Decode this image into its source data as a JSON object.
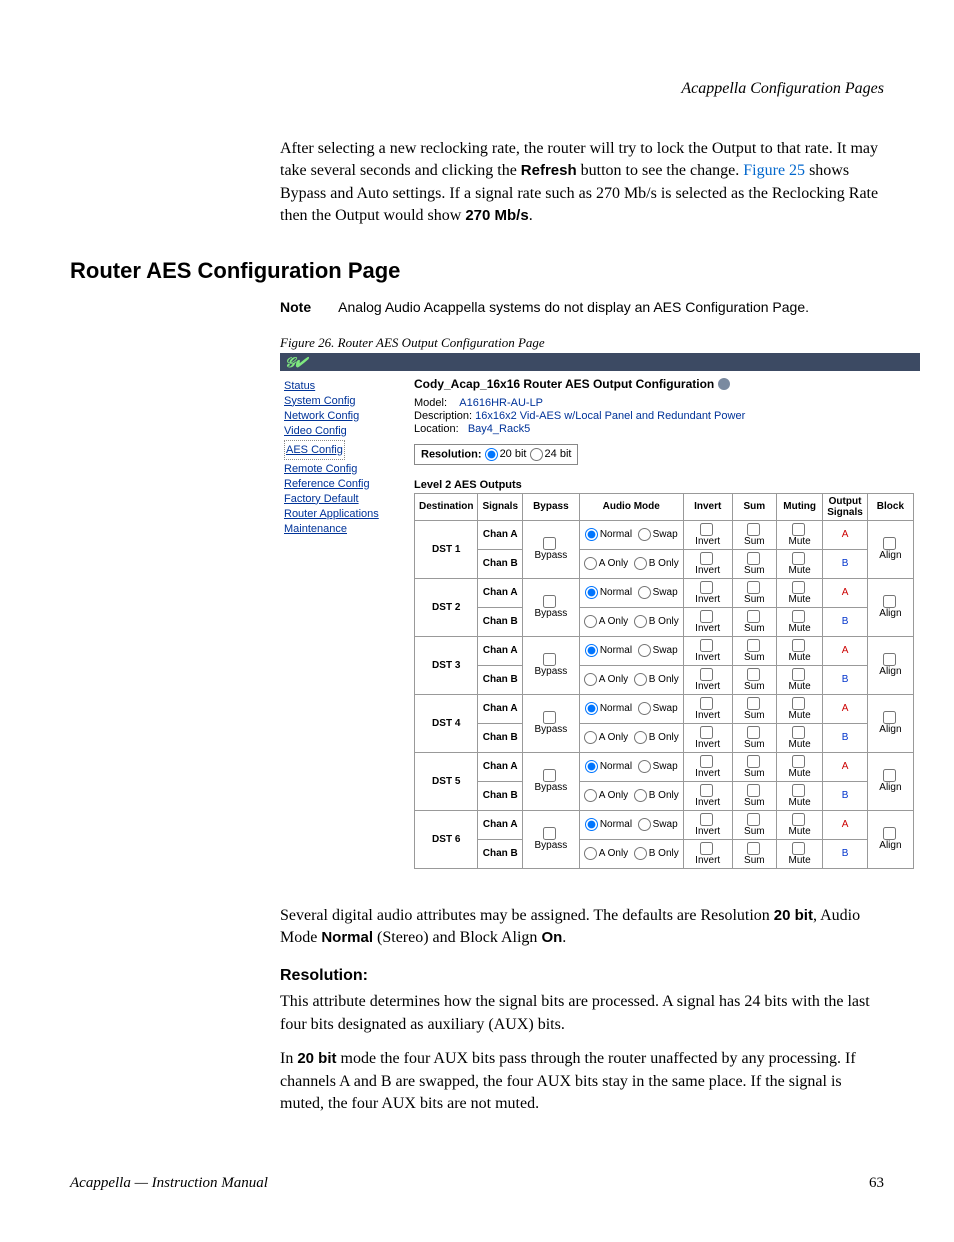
{
  "header": {
    "section_title": "Acappella Configuration Pages"
  },
  "intro": {
    "p1a": "After selecting a new reclocking rate, the router will try to lock the Output to that rate. It may take several seconds and clicking the ",
    "refresh": "Refresh",
    "p1b": " button to see the change. ",
    "figlink": "Figure 25",
    "p1c": " shows Bypass and Auto settings. If a signal rate such as 270 Mb/s is selected as the Reclocking Rate then the Output would show ",
    "rate": "270 Mb/s",
    "p1d": "."
  },
  "h2": "Router AES Configuration Page",
  "note": {
    "label": "Note",
    "text": "Analog Audio Acappella systems do not display an AES Configuration Page."
  },
  "figcap": "Figure 26.  Router AES Output Configuration Page",
  "shot": {
    "title": "Cody_Acap_16x16 Router AES Output Configuration",
    "model_l": "Model:",
    "model_v": "A1616HR-AU-LP",
    "desc_l": "Description:",
    "desc_v": "16x16x2 Vid-AES w/Local Panel and Redundant Power",
    "loc_l": "Location:",
    "loc_v": "Bay4_Rack5",
    "res_label": "Resolution:",
    "res_20": "20 bit",
    "res_24": "24 bit",
    "level": "Level 2 AES Outputs",
    "sidebar": [
      "Status",
      "System Config",
      "Network Config",
      "Video Config",
      "AES Config",
      "Remote Config",
      "Reference Config",
      "Factory Default",
      "Router Applications",
      "Maintenance"
    ],
    "cols": {
      "dest": "Destination",
      "sig": "Signals",
      "byp": "Bypass",
      "mode": "Audio Mode",
      "inv": "Invert",
      "sum": "Sum",
      "mut": "Muting",
      "out": "Output",
      "outsig": "Signals",
      "blk": "Block"
    },
    "labels": {
      "chanA": "Chan A",
      "chanB": "Chan B",
      "bypass": "Bypass",
      "normal": "Normal",
      "swap": "Swap",
      "aonly": "A Only",
      "bonly": "B Only",
      "invert": "Invert",
      "sum": "Sum",
      "mute": "Mute",
      "outA": "A",
      "outB": "B",
      "align": "Align"
    },
    "rows": [
      "DST 1",
      "DST 2",
      "DST 3",
      "DST 4",
      "DST 5",
      "DST 6"
    ]
  },
  "after": {
    "p1a": "Several digital audio attributes may be assigned. The defaults are Resolution ",
    "b1": "20 bit",
    "p1b": ", Audio Mode ",
    "b2": "Normal",
    "p1c": " (Stereo) and Block Align ",
    "b3": "On",
    "p1d": "."
  },
  "res_h": "Resolution:",
  "res_p1": "This attribute determines how the signal bits are processed. A signal has 24 bits with the last four bits designated as auxiliary (AUX) bits.",
  "res_p2a": "In ",
  "res_b": "20 bit",
  "res_p2b": " mode the four AUX bits pass through the router unaffected by any processing. If channels A and B are swapped, the four AUX bits stay in the same place. If the signal is muted, the four AUX bits are not muted.",
  "footer": {
    "left": "Acappella — Instruction Manual",
    "right": "63"
  }
}
